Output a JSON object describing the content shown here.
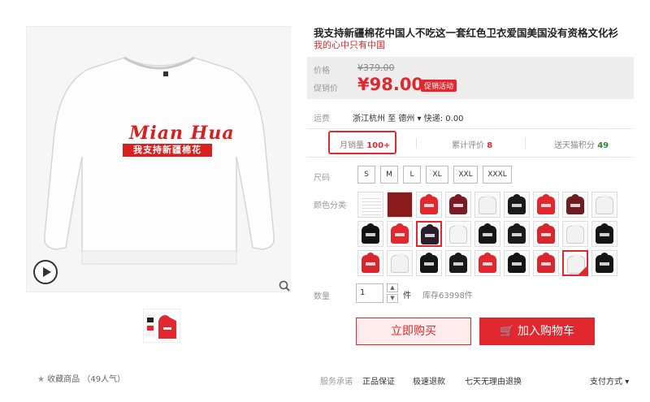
{
  "product": {
    "title": "我支持新疆棉花中国人不吃这一套红色卫衣爱国美国没有资格文化衫",
    "subtitle": "我的心中只有中国",
    "brand_script": "Mian Hua",
    "brand_bar": "我支持新疆棉花"
  },
  "price": {
    "original_label": "价格",
    "original_value": "¥379.00",
    "promo_label": "促销价",
    "promo_value": "¥98.00",
    "promo_badge": "促销活动"
  },
  "shipping": {
    "label": "运费",
    "value": "浙江杭州 至 德州 ▾ 快递: 0.00"
  },
  "stats": {
    "monthly_sales_label": "月销量",
    "monthly_sales_value": "100+",
    "reviews_label": "累计评价",
    "reviews_value": "8",
    "points_label": "送天猫积分",
    "points_value": "49"
  },
  "size": {
    "label": "尺码",
    "options": [
      "S",
      "M",
      "L",
      "XL",
      "XXL",
      "XXXL"
    ]
  },
  "color": {
    "label": "颜色分类"
  },
  "quantity": {
    "label": "数量",
    "value": "1",
    "unit": "件",
    "stock": "库存63998件"
  },
  "actions": {
    "buy_now": "立即购买",
    "add_to_cart": "加入购物车"
  },
  "favorite": {
    "text": "收藏商品",
    "count": "（49人气）"
  },
  "service": {
    "label": "服务承诺",
    "items": [
      "正品保证",
      "极速退款",
      "七天无理由退换"
    ],
    "payment": "支付方式"
  },
  "colors": {
    "accent": "#e0282e",
    "points_green": "#2e8b30"
  }
}
